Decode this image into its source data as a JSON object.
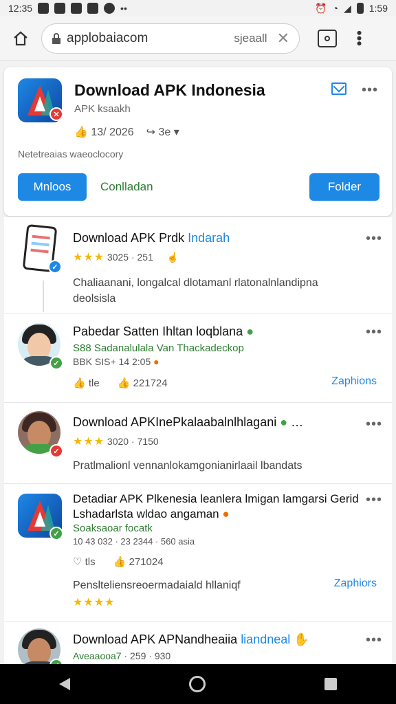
{
  "status_bar": {
    "time_left": "12:35",
    "time_right": "1:59"
  },
  "browser": {
    "url": "applobaiacom",
    "hint": "sjeaall"
  },
  "hero": {
    "title": "Download APK Indonesia",
    "subtitle": "APK ksaakh",
    "stat_likes": "13/ 2026",
    "stat_shares": "3e",
    "description": "Netetreaias waeoclocory",
    "btn_left": "Mnloos",
    "link_middle": "Conlladan",
    "btn_right": "Folder"
  },
  "feed": [
    {
      "title": "Download APK Prdk",
      "title_accent": "Indarah",
      "stars": "★★★",
      "meta": "3025 · 251",
      "body": "Chaliaanani, longalcal dlotamanl rlatonalnlandipna deolsisla"
    },
    {
      "title": "Pabedar Satten Ihltan loqblana",
      "meta_green": "S88 Sadanalulala Van Thackadeckop",
      "meta": "BBK SIS+ 14 2:05",
      "action_1": "tle",
      "action_2": "221724",
      "link": "Zaphions"
    },
    {
      "title": "Download APKInePkalaabalnlhlagani",
      "stars": "★★★",
      "meta": "3020 · 7150",
      "body": "Pratlmalionl vennanlokamgonianirlaail lbandats"
    },
    {
      "title_line1": "Detadiar APK Plkenesia leanlera lmigan lamgarsi Gerid",
      "title_line2": "Lshadarlsta wldao angaman",
      "meta_green": "Soaksaoar focatk",
      "meta": "10 43 032 · 23 2344 · 560 asia",
      "action_1": "tls",
      "action_2": "271024",
      "body": "Penslteliensreoermadaiald hllaniqf",
      "link": "Zaphiors",
      "stars": "★★★★"
    },
    {
      "title": "Download APK APNandheaiia",
      "title_accent": "liandneal",
      "meta_green": "Aveaaooa7",
      "meta": "259 · 930"
    }
  ],
  "colors": {
    "accent": "#1e88e5",
    "green": "#2e7d32",
    "star": "#f5b800"
  }
}
